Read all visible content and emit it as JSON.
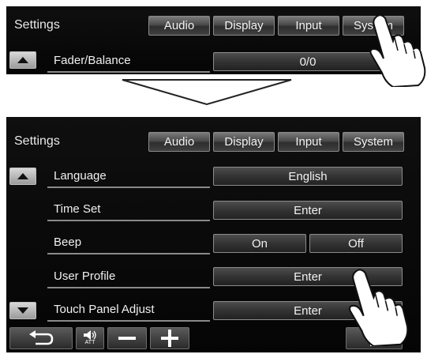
{
  "top_panel": {
    "title": "Settings",
    "tabs": [
      "Audio",
      "Display",
      "Input",
      "System"
    ],
    "row": {
      "label": "Fader/Balance",
      "value": "0/0"
    }
  },
  "bottom_panel": {
    "title": "Settings",
    "tabs": [
      "Audio",
      "Display",
      "Input",
      "System"
    ],
    "rows": [
      {
        "label": "Language",
        "value": "English"
      },
      {
        "label": "Time Set",
        "value": "Enter"
      },
      {
        "label": "Beep",
        "options": [
          "On",
          "Off"
        ]
      },
      {
        "label": "User Profile",
        "value": "Enter"
      },
      {
        "label": "Touch Panel Adjust",
        "value": "Enter"
      }
    ],
    "bottom_bar": {
      "att_label": "ATT"
    }
  },
  "icons": {
    "scroll_up": "triangle-up-icon",
    "scroll_down": "triangle-down-icon",
    "back": "return-arrow-icon",
    "att": "speaker-att-icon",
    "minus": "minus-icon",
    "plus": "plus-icon",
    "exit": "exit-door-icon",
    "hand": "tapping-hand-icon"
  }
}
